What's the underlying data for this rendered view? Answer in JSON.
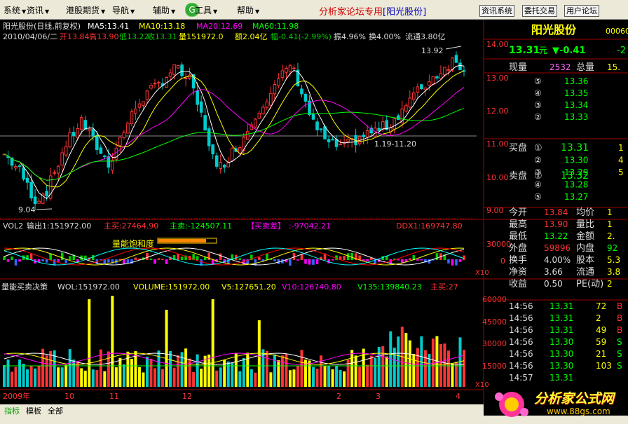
{
  "menu": {
    "items": [
      {
        "label": "系统"
      },
      {
        "label": "资讯"
      },
      {
        "label": "港股期货"
      },
      {
        "label": "导航"
      },
      {
        "label": "辅助"
      },
      {
        "label": "工具"
      },
      {
        "label": "帮助"
      }
    ],
    "app_title": "分析家论坛专用",
    "app_stock": "[阳光股份]",
    "buttons": [
      "资讯系统",
      "委托交易",
      "用户论坛"
    ]
  },
  "main_chart": {
    "info_line1": {
      "name": "阳光股份(日线,前复权)",
      "ma5": "MA5:13.41",
      "ma10": "MA10:13.18",
      "ma20": "MA20:12.69",
      "ma60": "MA60:11.98"
    },
    "info_line2": {
      "date": "2010/04/06/二",
      "open": "开13.84",
      "high": "高13.90",
      "low": "低13.22",
      "close": "收13.31",
      "volume": "量151972.0",
      "amount": "额2.04亿",
      "change": "幅-0.41(-2.99%)",
      "amplitude": "振4.96%",
      "turnover": "换4.00%",
      "float": "流通3.80亿"
    },
    "y_axis": [
      "14.00",
      "13.00",
      "12.00",
      "11.00",
      "10.00",
      "9.00"
    ],
    "annotations": {
      "high": "13.92",
      "low": "9.04",
      "range": "1.19-11.20"
    }
  },
  "indicator1": {
    "title": "VOL2",
    "out1": "输出1:151972.00",
    "buy": "主买:27464.90",
    "sell": "主卖:-124507.11",
    "diff_label": "【买卖差】",
    "diff_val": ":-97042.21",
    "ddx": "DDX1:169747.80",
    "annotation": "量能饱和度",
    "y_axis": [
      "30000",
      "0"
    ],
    "scale": "X10"
  },
  "indicator2": {
    "title": "量能买卖决策",
    "wol": "WOL:151972.00",
    "volume": "VOLUME:151972.00",
    "v5": "V5:127651.20",
    "v10": "V10:126740.80",
    "v135": "V135:139840.23",
    "buy": "主买:27",
    "y_axis": [
      "60000",
      "45000",
      "30000",
      "15000"
    ],
    "scale": "X10"
  },
  "time_axis": [
    "2009年",
    "10",
    "11",
    "12",
    "2",
    "3",
    "4"
  ],
  "bottom_tabs": [
    "指标",
    "模板",
    "全部"
  ],
  "quote": {
    "name": "阳光股份",
    "code": "00060",
    "price": "13.31",
    "price_unit": "元",
    "change": "▼-0.41",
    "change_pct": "-2",
    "volume_label": "现量",
    "volume": "2532",
    "total_label": "总量",
    "total": "15.",
    "sell_label": "卖盘",
    "buy_label": "买盘",
    "asks": [
      {
        "level": "⑤",
        "price": "13.36"
      },
      {
        "level": "④",
        "price": "13.35"
      },
      {
        "level": "③",
        "price": "13.34"
      },
      {
        "level": "②",
        "price": "13.33"
      },
      {
        "level": "①",
        "price": "13.32"
      }
    ],
    "bids": [
      {
        "level": "①",
        "price": "13.31",
        "vol": "1"
      },
      {
        "level": "②",
        "price": "13.30",
        "vol": "4"
      },
      {
        "level": "③",
        "price": "13.29",
        "vol": "5"
      },
      {
        "level": "④",
        "price": "13.28",
        "vol": ""
      },
      {
        "level": "⑤",
        "price": "13.27",
        "vol": ""
      }
    ],
    "stats": [
      {
        "l1": "今开",
        "v1": "13.84",
        "l2": "均价",
        "v2": "1"
      },
      {
        "l1": "最高",
        "v1": "13.90",
        "l2": "量比",
        "v2": "1"
      },
      {
        "l1": "最低",
        "v1": "13.22",
        "l2": "金额",
        "v2": "2."
      },
      {
        "l1": "外盘",
        "v1": "59896",
        "l2": "内盘",
        "v2": "92"
      },
      {
        "l1": "换手",
        "v1": "4.00%",
        "l2": "股本",
        "v2": "5.3"
      },
      {
        "l1": "净资",
        "v1": "3.66",
        "l2": "流通",
        "v2": "3.8"
      },
      {
        "l1": "收益",
        "v1": "0.50",
        "l2": "PE(动)",
        "v2": "2"
      }
    ],
    "ticks": [
      {
        "time": "14:56",
        "price": "13.31",
        "vol": "72",
        "dir": "B"
      },
      {
        "time": "14:56",
        "price": "13.31",
        "vol": "2",
        "dir": "B"
      },
      {
        "time": "14:56",
        "price": "13.31",
        "vol": "49",
        "dir": "B"
      },
      {
        "time": "14:56",
        "price": "13.30",
        "vol": "59",
        "dir": "S"
      },
      {
        "time": "14:56",
        "price": "13.30",
        "vol": "21",
        "dir": "S"
      },
      {
        "time": "14:56",
        "price": "13.30",
        "vol": "103",
        "dir": "S"
      },
      {
        "time": "14:57",
        "price": "13.31",
        "vol": "",
        "dir": ""
      }
    ]
  },
  "watermark": {
    "title": "分析家公式网",
    "url": "www.88gs.com"
  },
  "colors": {
    "up": "#ff3333",
    "down": "#00cccc",
    "ma5": "#ffffff",
    "ma10": "#ffff00",
    "ma20": "#ff00ff",
    "ma60": "#00ff00",
    "grid": "#800000"
  }
}
